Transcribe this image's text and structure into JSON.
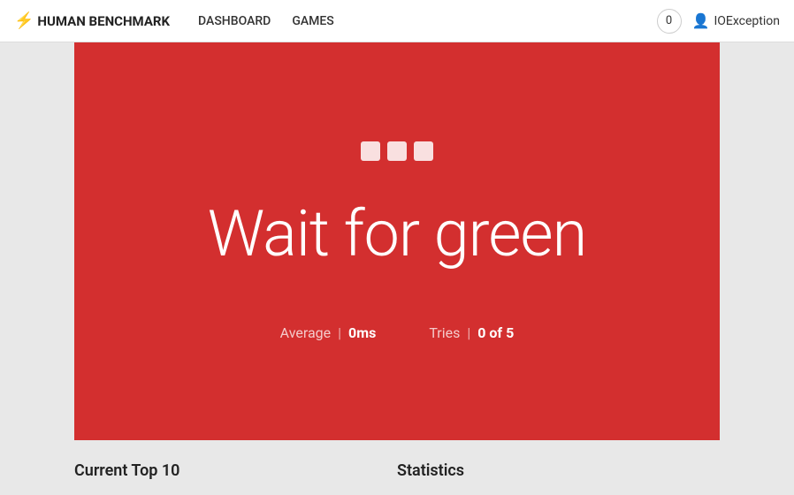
{
  "nav": {
    "brand_label": "HUMAN BENCHMARK",
    "bolt": "⚡",
    "links": [
      "DASHBOARD",
      "GAMES"
    ],
    "badge_count": "0",
    "user_label": "IOException",
    "user_icon": "👤"
  },
  "game": {
    "dots": [
      1,
      2,
      3
    ],
    "title": "Wait for green",
    "average_label": "Average",
    "average_separator": "|",
    "average_value": "0ms",
    "tries_label": "Tries",
    "tries_separator": "|",
    "tries_value": "0 of 5"
  },
  "bottom": {
    "top10_label": "Current Top 10",
    "statistics_label": "Statistics"
  }
}
